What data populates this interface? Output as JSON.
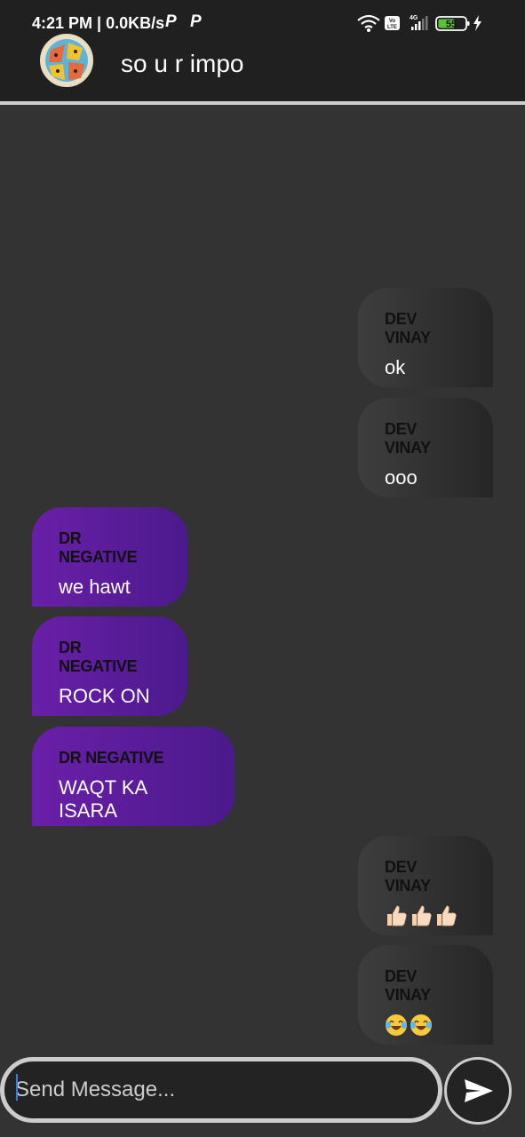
{
  "status_bar": {
    "time": "4:21 PM | 0.0KB/s",
    "notif_icon_1": "P",
    "notif_icon_2": "P",
    "volte": "Vo\nLTE",
    "network": "4G",
    "battery": "55"
  },
  "header": {
    "title": "so u r impo",
    "avatar": "group-avatar"
  },
  "messages": [
    {
      "side": "right",
      "sender": "DEV VINAY",
      "text": "ok"
    },
    {
      "side": "right",
      "sender": "DEV VINAY",
      "text": "ooo"
    },
    {
      "side": "left",
      "sender": "DR NEGATIVE",
      "text": "we hawt"
    },
    {
      "side": "left",
      "sender": "DR NEGATIVE",
      "text": "ROCK ON"
    },
    {
      "side": "left",
      "sender": "DR NEGATIVE",
      "text": "WAQT KA ISARA"
    },
    {
      "side": "right",
      "sender": "DEV VINAY",
      "emoji": "thumbs-up x3"
    },
    {
      "side": "right",
      "sender": "DEV VINAY",
      "emoji": "tears-of-joy x2"
    }
  ],
  "composer": {
    "placeholder": "Send Message...",
    "send_icon": "send-icon"
  },
  "colors": {
    "background": "#333333",
    "bar": "#202020",
    "incoming_bubble": "#6a1fa8",
    "outgoing_bubble": "#3e3e3e"
  }
}
